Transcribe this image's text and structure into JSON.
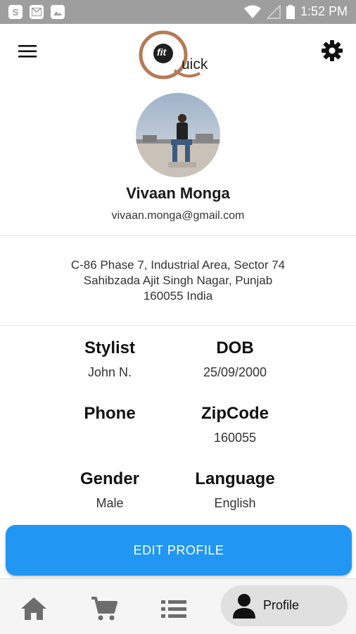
{
  "status_bar": {
    "time": "1:52 PM",
    "left_icons": [
      "skype-icon",
      "mail-icon",
      "image-icon"
    ],
    "right_icons": [
      "wifi-icon",
      "signal-icon",
      "battery-icon"
    ]
  },
  "header": {
    "logo_text": "uick",
    "logo_badge": "fit"
  },
  "profile": {
    "name": "Vivaan Monga",
    "email": "vivaan.monga@gmail.com",
    "address_lines": [
      "C-86 Phase 7, Industrial Area, Sector 74",
      "Sahibzada Ajit Singh Nagar, Punjab",
      "160055 India"
    ]
  },
  "details": [
    {
      "label": "Stylist",
      "value": "John N."
    },
    {
      "label": "DOB",
      "value": "25/09/2000"
    },
    {
      "label": "Phone",
      "value": ""
    },
    {
      "label": "ZipCode",
      "value": "160055"
    },
    {
      "label": "Gender",
      "value": "Male"
    },
    {
      "label": "Language",
      "value": "English"
    }
  ],
  "actions": {
    "edit_profile": "EDIT PROFILE"
  },
  "bottom_nav": {
    "items": [
      "home-icon",
      "cart-icon",
      "list-icon",
      "profile-icon"
    ],
    "active_label": "Profile"
  },
  "colors": {
    "primary": "#2196f3",
    "status_bar": "#9e9e9e",
    "logo_accent": "#b57a55",
    "nav_active_bg": "#e0e0e0"
  }
}
